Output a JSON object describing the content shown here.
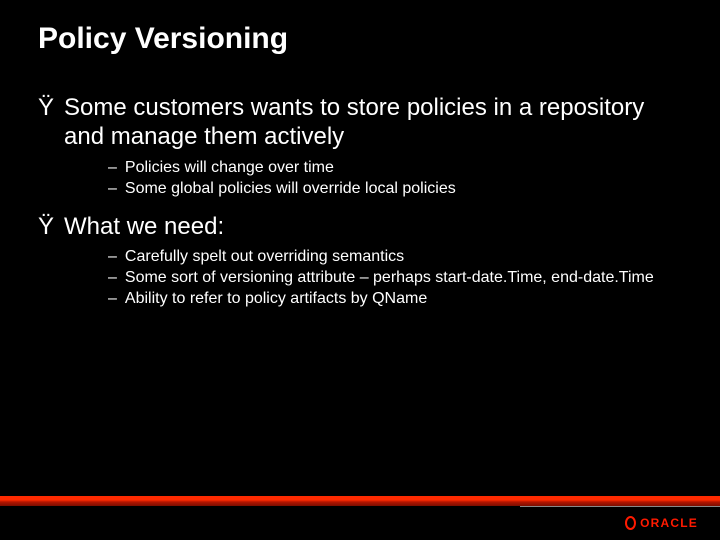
{
  "title": "Policy Versioning",
  "bullets": {
    "b0": {
      "marker": "Ÿ",
      "text": "Some customers wants to store policies in a repository and manage them actively",
      "subs": {
        "s0": {
          "marker": "–",
          "text": "Policies will change over time"
        },
        "s1": {
          "marker": "–",
          "text": "Some global policies will override local policies"
        }
      }
    },
    "b1": {
      "marker": "Ÿ",
      "text": "What we need:",
      "subs": {
        "s0": {
          "marker": "–",
          "text": "Carefully spelt out overriding semantics"
        },
        "s1": {
          "marker": "–",
          "text": "Some sort of versioning attribute – perhaps start-date.Time, end-date.Time"
        },
        "s2": {
          "marker": "–",
          "text": "Ability to refer to policy artifacts by QName"
        }
      }
    }
  },
  "brand": "ORACLE"
}
